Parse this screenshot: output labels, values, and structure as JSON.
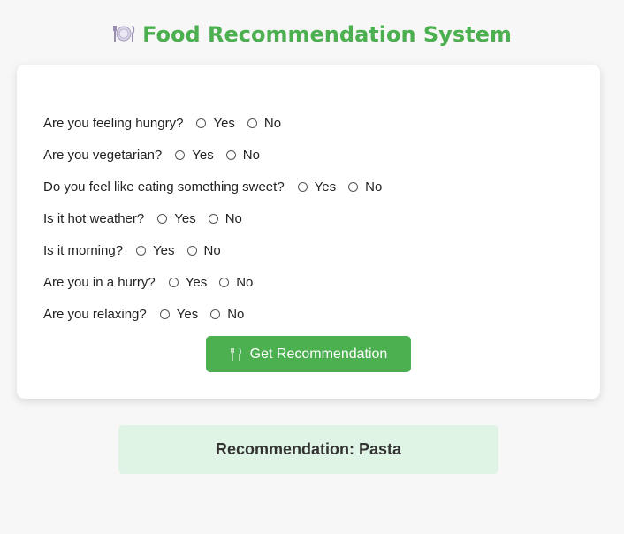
{
  "app": {
    "title": "Food Recommendation System",
    "title_icon": "plate-icon",
    "accent_color": "#4caf50"
  },
  "questions": [
    {
      "text": "Are you feeling hungry?",
      "options": [
        "Yes",
        "No"
      ]
    },
    {
      "text": "Are you vegetarian?",
      "options": [
        "Yes",
        "No"
      ]
    },
    {
      "text": "Do you feel like eating something sweet?",
      "options": [
        "Yes",
        "No"
      ]
    },
    {
      "text": "Is it hot weather?",
      "options": [
        "Yes",
        "No"
      ]
    },
    {
      "text": "Is it morning?",
      "options": [
        "Yes",
        "No"
      ]
    },
    {
      "text": "Are you in a hurry?",
      "options": [
        "Yes",
        "No"
      ]
    },
    {
      "text": "Are you relaxing?",
      "options": [
        "Yes",
        "No"
      ]
    }
  ],
  "button": {
    "label": "Get Recommendation",
    "icon": "fork-knife-icon"
  },
  "result": {
    "text": "Recommendation: Pasta",
    "background_color": "#e0f4e6"
  }
}
